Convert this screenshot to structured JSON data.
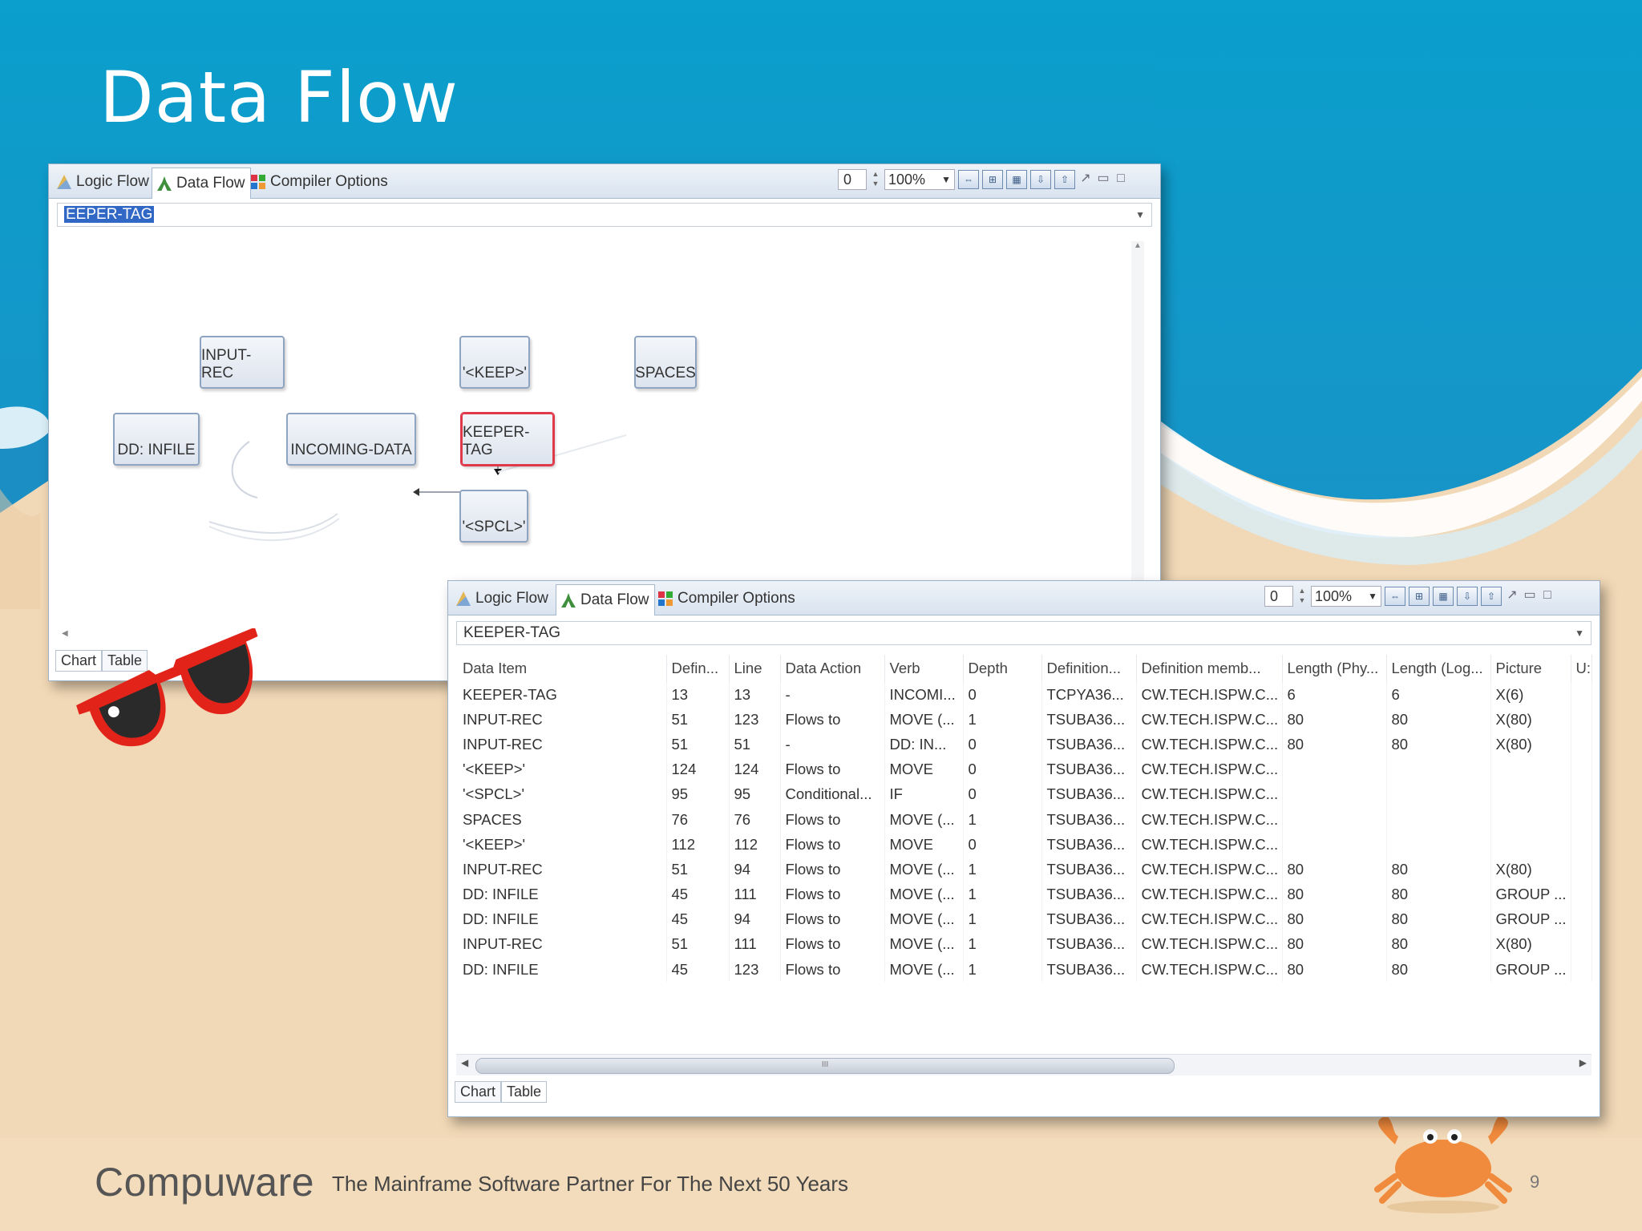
{
  "slide": {
    "title": "Data Flow",
    "footer_logo": "Compuware",
    "footer_tagline": "The Mainframe Software Partner For The Next 50 Years",
    "page_number": "9"
  },
  "colors": {
    "ocean": "#0ba3cf",
    "sand": "#f1d7b4",
    "selection_red": "#e0394a"
  },
  "chart_panel": {
    "tabs": [
      {
        "label": "Logic Flow",
        "icon": "logic-flow-icon"
      },
      {
        "label": "Data Flow",
        "icon": "data-flow-icon"
      },
      {
        "label": "Compiler Options",
        "icon": "compiler-options-icon"
      }
    ],
    "depth_value": "0",
    "zoom_value": "100%",
    "selected_item": "KEEPER-TAG",
    "selected_item_visible": "EEPER-TAG",
    "nodes": [
      {
        "label": "INPUT-REC"
      },
      {
        "label": "DD:  INFILE"
      },
      {
        "label": "INCOMING-DATA"
      },
      {
        "label": "'<KEEP>'"
      },
      {
        "label": "KEEPER-TAG"
      },
      {
        "label": "SPACES"
      },
      {
        "label": "'<SPCL>'"
      }
    ],
    "bottom_tabs": [
      "Chart",
      "Table"
    ]
  },
  "table_panel": {
    "tabs": [
      {
        "label": "Logic Flow",
        "icon": "logic-flow-icon"
      },
      {
        "label": "Data Flow",
        "icon": "data-flow-icon"
      },
      {
        "label": "Compiler Options",
        "icon": "compiler-options-icon"
      }
    ],
    "depth_value": "0",
    "zoom_value": "100%",
    "selected_item": "KEEPER-TAG",
    "columns": [
      "Data Item",
      "Defin...",
      "Line",
      "Data Action",
      "Verb",
      "Depth",
      "Definition...",
      "Definition memb...",
      "Length (Phy...",
      "Length (Log...",
      "Picture",
      "U:"
    ],
    "rows": [
      [
        "KEEPER-TAG",
        "13",
        "13",
        "-",
        "INCOMI...",
        "0",
        "TCPYA36...",
        "CW.TECH.ISPW.C...",
        "6",
        "6",
        "X(6)",
        ""
      ],
      [
        "INPUT-REC",
        "51",
        "123",
        "Flows to",
        "MOVE (...",
        "1",
        "TSUBA36...",
        "CW.TECH.ISPW.C...",
        "80",
        "80",
        "X(80)",
        ""
      ],
      [
        "INPUT-REC",
        "51",
        "51",
        "-",
        "DD:  IN...",
        "0",
        "TSUBA36...",
        "CW.TECH.ISPW.C...",
        "80",
        "80",
        "X(80)",
        ""
      ],
      [
        "'<KEEP>'",
        "124",
        "124",
        "Flows to",
        "MOVE",
        "0",
        "TSUBA36...",
        "CW.TECH.ISPW.C...",
        "",
        "",
        "",
        ""
      ],
      [
        "'<SPCL>'",
        "95",
        "95",
        "Conditional...",
        "IF",
        "0",
        "TSUBA36...",
        "CW.TECH.ISPW.C...",
        "",
        "",
        "",
        ""
      ],
      [
        "SPACES",
        "76",
        "76",
        "Flows to",
        "MOVE (...",
        "1",
        "TSUBA36...",
        "CW.TECH.ISPW.C...",
        "",
        "",
        "",
        ""
      ],
      [
        "'<KEEP>'",
        "112",
        "112",
        "Flows to",
        "MOVE",
        "0",
        "TSUBA36...",
        "CW.TECH.ISPW.C...",
        "",
        "",
        "",
        ""
      ],
      [
        "INPUT-REC",
        "51",
        "94",
        "Flows to",
        "MOVE (...",
        "1",
        "TSUBA36...",
        "CW.TECH.ISPW.C...",
        "80",
        "80",
        "X(80)",
        ""
      ],
      [
        "DD:  INFILE",
        "45",
        "111",
        "Flows to",
        "MOVE (...",
        "1",
        "TSUBA36...",
        "CW.TECH.ISPW.C...",
        "80",
        "80",
        "GROUP ...",
        ""
      ],
      [
        "DD:  INFILE",
        "45",
        "94",
        "Flows to",
        "MOVE (...",
        "1",
        "TSUBA36...",
        "CW.TECH.ISPW.C...",
        "80",
        "80",
        "GROUP ...",
        ""
      ],
      [
        "INPUT-REC",
        "51",
        "111",
        "Flows to",
        "MOVE (...",
        "1",
        "TSUBA36...",
        "CW.TECH.ISPW.C...",
        "80",
        "80",
        "X(80)",
        ""
      ],
      [
        "DD:  INFILE",
        "45",
        "123",
        "Flows to",
        "MOVE (...",
        "1",
        "TSUBA36...",
        "CW.TECH.ISPW.C...",
        "80",
        "80",
        "GROUP ...",
        ""
      ]
    ],
    "scroll_grip": "III",
    "bottom_tabs": [
      "Chart",
      "Table"
    ]
  }
}
